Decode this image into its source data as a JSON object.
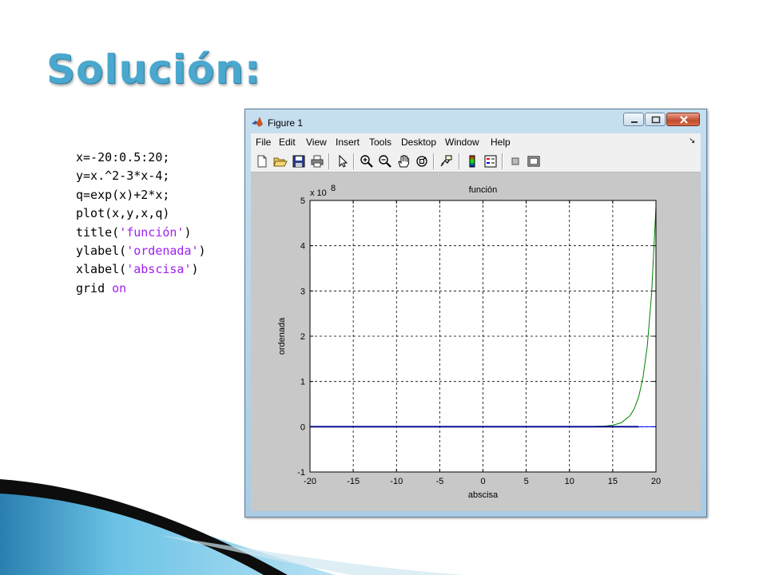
{
  "slide": {
    "title": "Solución:"
  },
  "code": {
    "lines": [
      {
        "pre": "x=-20:0.5:20;",
        "str": "",
        "post": ""
      },
      {
        "pre": "y=x.^2-3*x-4;",
        "str": "",
        "post": ""
      },
      {
        "pre": "q=exp(x)+2*x;",
        "str": "",
        "post": ""
      },
      {
        "pre": "plot(x,y,x,q)",
        "str": "",
        "post": ""
      },
      {
        "pre": "title(",
        "str": "'función'",
        "post": ")"
      },
      {
        "pre": "ylabel(",
        "str": "'ordenada'",
        "post": ")"
      },
      {
        "pre": "xlabel(",
        "str": "'abscisa'",
        "post": ")"
      },
      {
        "pre": "grid ",
        "str": "on",
        "post": ""
      }
    ]
  },
  "window": {
    "title": "Figure 1",
    "menu": [
      "File",
      "Edit",
      "View",
      "Insert",
      "Tools",
      "Desktop",
      "Window",
      "Help"
    ],
    "toolbar_icons": [
      "new-file-icon",
      "open-folder-icon",
      "save-icon",
      "print-icon",
      "pointer-icon",
      "zoom-in-icon",
      "zoom-out-icon",
      "pan-hand-icon",
      "rotate-3d-icon",
      "data-cursor-icon",
      "colorbar-icon",
      "legend-icon",
      "hide-plot-tools-icon",
      "show-plot-tools-icon"
    ]
  },
  "chart_data": {
    "type": "line",
    "title": "función",
    "xlabel": "abscisa",
    "ylabel": "ordenada",
    "exponent_label": "x 10",
    "exponent_power": "8",
    "xlim": [
      -20,
      20
    ],
    "ylim": [
      -1,
      5
    ],
    "y_scale": 100000000,
    "xticks": [
      "-20",
      "-15",
      "-10",
      "-5",
      "0",
      "5",
      "10",
      "15",
      "20"
    ],
    "yticks": [
      "-1",
      "0",
      "1",
      "2",
      "3",
      "4",
      "5"
    ],
    "grid": true,
    "series": [
      {
        "color": "#0000ff",
        "x": [
          -20,
          -10,
          0,
          10,
          20
        ],
        "y": [
          0,
          0,
          0,
          0,
          0
        ]
      },
      {
        "color": "#008000",
        "x": [
          -20,
          0,
          12,
          14,
          15,
          16,
          17,
          17.5,
          18,
          18.5,
          19,
          19.5,
          20
        ],
        "y": [
          0,
          0,
          0.0016,
          0.012,
          0.033,
          0.089,
          0.242,
          0.4,
          0.657,
          1.083,
          1.785,
          2.943,
          4.852
        ]
      }
    ],
    "series_overlap_color": "#00008b"
  },
  "colors": {
    "title": "#4aa8cf",
    "string": "#a020f0",
    "axes_bg": "#ffffff",
    "figure_bg": "#c8c8c8"
  }
}
